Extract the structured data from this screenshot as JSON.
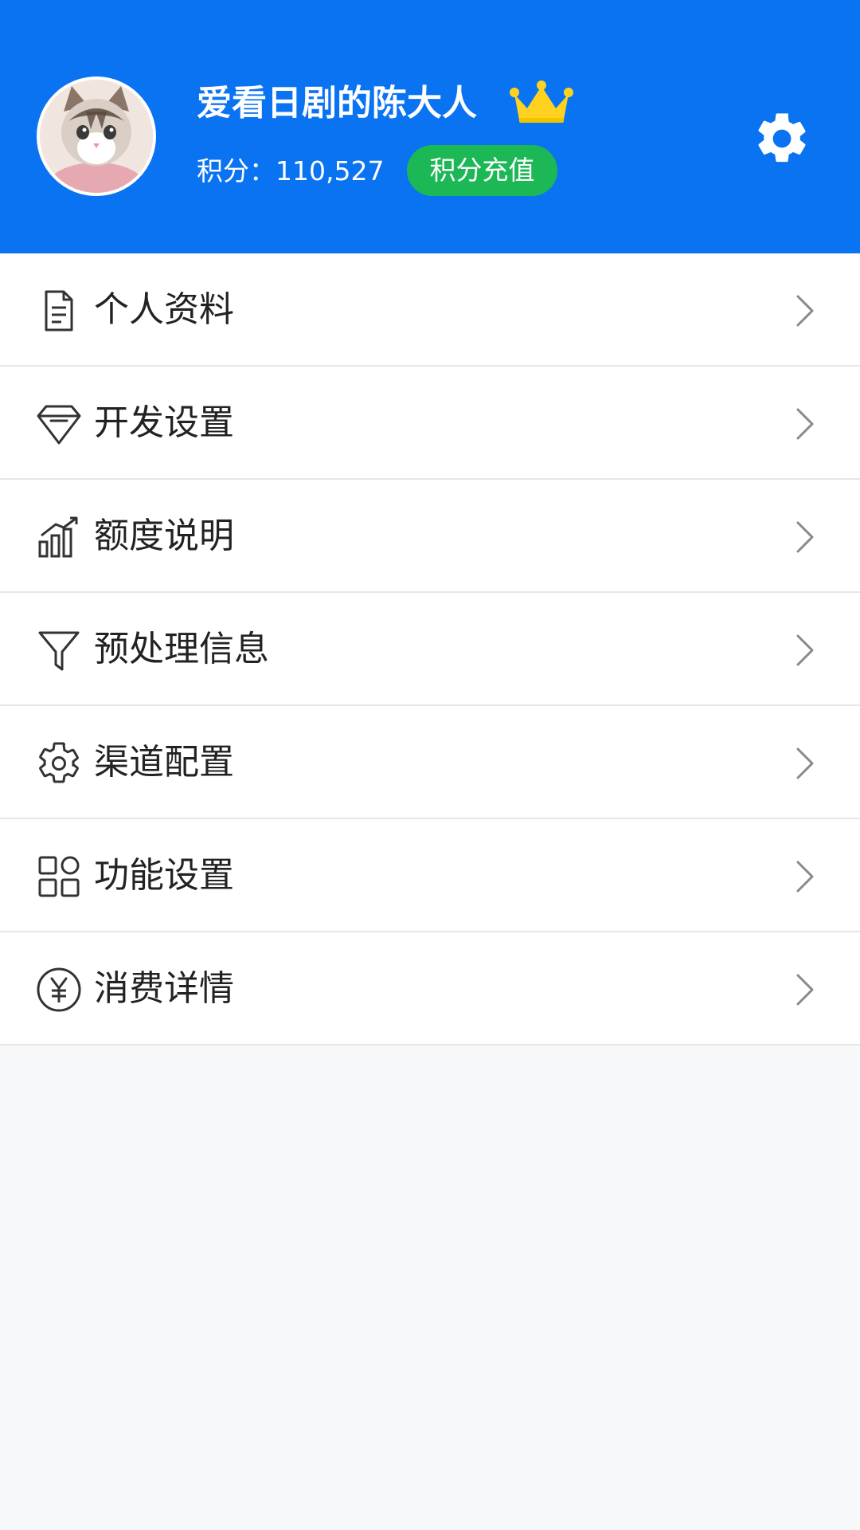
{
  "profile": {
    "username": "爱看日剧的陈大人",
    "points_text": "积分：110,527",
    "recharge_label": "积分充值",
    "crown_icon": "crown-icon",
    "settings_icon": "gear-icon"
  },
  "menu": {
    "items": [
      {
        "label": "个人资料",
        "icon": "document-icon"
      },
      {
        "label": "开发设置",
        "icon": "diamond-icon"
      },
      {
        "label": "额度说明",
        "icon": "bar-chart-icon"
      },
      {
        "label": "预处理信息",
        "icon": "filter-icon"
      },
      {
        "label": "渠道配置",
        "icon": "gear-icon"
      },
      {
        "label": "功能设置",
        "icon": "grid-icon"
      },
      {
        "label": "消费详情",
        "icon": "yen-icon"
      }
    ]
  },
  "colors": {
    "header_bg": "#0a73f1",
    "recharge_bg": "#1cb856",
    "crown": "#ffd21f",
    "page_bg": "#f7f8fa"
  }
}
